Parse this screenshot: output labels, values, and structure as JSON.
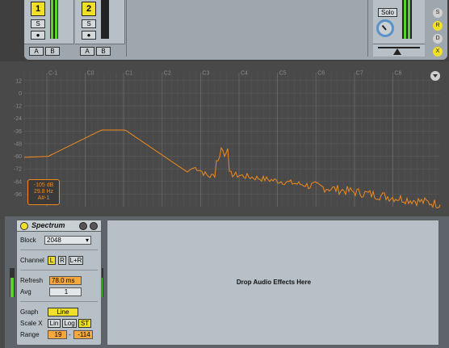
{
  "mixer": {
    "tracks": [
      {
        "number": "1",
        "solo": "S",
        "arm": "●",
        "a": "A",
        "b": "B",
        "meter_level": 1.0
      },
      {
        "number": "2",
        "solo": "S",
        "arm": "●",
        "a": "A",
        "b": "B",
        "meter_level": 0.0
      }
    ],
    "master": {
      "solo": "Solo"
    },
    "side_buttons": [
      "S",
      "R",
      "D",
      "X"
    ]
  },
  "spectrum": {
    "chart_data": {
      "type": "line",
      "db_ticks": [
        "12",
        "0",
        "-12",
        "-24",
        "-36",
        "-48",
        "-60",
        "-72",
        "-84",
        "-96"
      ],
      "note_ticks": [
        "C-1",
        "C0",
        "C1",
        "C2",
        "C3",
        "C4",
        "C5",
        "C6",
        "C7",
        "C8"
      ],
      "ylim": [
        -108,
        18
      ],
      "color": "#f08a1c"
    },
    "readout": {
      "line1": "-105 dB",
      "line2": "29.8 Hz",
      "line3": "A#-1"
    }
  },
  "device": {
    "name": "Spectrum",
    "block_label": "Block",
    "block_value": "2048",
    "channel_label": "Channel",
    "channel_options": [
      "L",
      "R",
      "L+R"
    ],
    "refresh_label": "Refresh",
    "refresh_value": "78.0 ms",
    "avg_label": "Avg",
    "avg_value": "1",
    "graph_label": "Graph",
    "graph_value": "Line",
    "scalex_label": "Scale X",
    "scalex_options": [
      "Lin",
      "Log",
      "ST"
    ],
    "range_label": "Range",
    "range_min": "19",
    "range_max": "-114"
  },
  "drop_zone": {
    "text": "Drop Audio Effects Here"
  }
}
